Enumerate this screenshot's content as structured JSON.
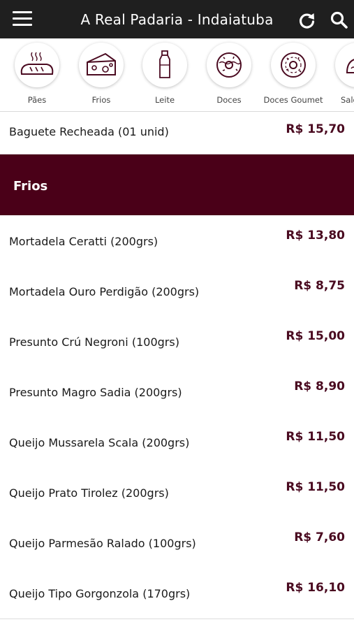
{
  "header": {
    "title": "A Real Padaria - Indaiatuba"
  },
  "categories": [
    {
      "label": "Pães",
      "icon": "bread-icon"
    },
    {
      "label": "Frios",
      "icon": "cheese-icon"
    },
    {
      "label": "Leite",
      "icon": "milk-bottle-icon"
    },
    {
      "label": "Doces",
      "icon": "donut-icon"
    },
    {
      "label": "Doces Goumet",
      "icon": "donut-icon"
    },
    {
      "label": "Salg",
      "icon": "savory-icon"
    }
  ],
  "top_item": {
    "name": "Baguete Recheada (01 unid)",
    "price": "R$ 15,70"
  },
  "section": {
    "title": "Frios"
  },
  "products": [
    {
      "name": "Mortadela Ceratti (200grs)",
      "price": "R$ 13,80"
    },
    {
      "name": "Mortadela Ouro Perdigão (200grs)",
      "price": "R$ 8,75"
    },
    {
      "name": "Presunto Crú Negroni (100grs)",
      "price": "R$ 15,00"
    },
    {
      "name": "Presunto Magro Sadia (200grs)",
      "price": "R$ 8,90"
    },
    {
      "name": "Queijo Mussarela Scala (200grs)",
      "price": "R$ 11,50"
    },
    {
      "name": "Queijo Prato Tirolez (200grs)",
      "price": "R$ 11,50"
    },
    {
      "name": "Queijo Parmesão Ralado (100grs)",
      "price": "R$ 7,60"
    },
    {
      "name": "Queijo Tipo Gorgonzola (170grs)",
      "price": "R$ 16,10"
    }
  ],
  "colors": {
    "topbar": "#1f1f1f",
    "accent": "#4a0018",
    "price": "#4a0a20"
  }
}
